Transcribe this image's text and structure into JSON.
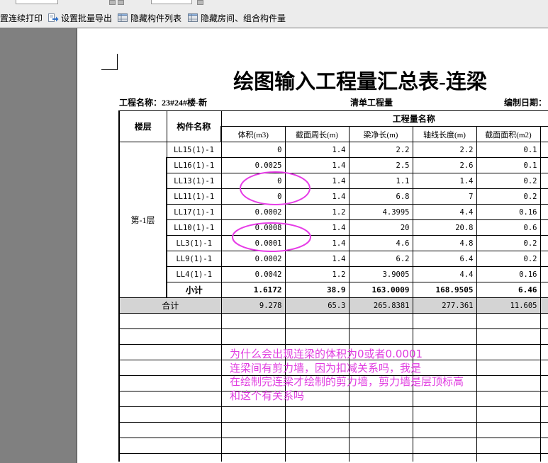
{
  "toolbar": {
    "items": [
      {
        "label": "置连续打印"
      },
      {
        "label": "设置批量导出",
        "icon": "export-icon"
      },
      {
        "label": "隐藏构件列表",
        "icon": "table-icon"
      },
      {
        "label": "隐藏房间、组合构件量",
        "icon": "table-icon"
      }
    ]
  },
  "report": {
    "title": "绘图输入工程量汇总表-连梁",
    "project": "工程名称：23#24#楼-新",
    "quantity_type": "清单工程量",
    "date_label": "编制日期：",
    "header_floor": "楼层",
    "header_component": "构件名称",
    "header_group": "工程量名称",
    "columns": [
      "体积(m3)",
      "截面周长(m)",
      "梁净长(m)",
      "轴线长度(m)",
      "截面面积(m2)"
    ],
    "floor": "第-1层",
    "rows": [
      {
        "name": "LL15(1)-1",
        "values": [
          "0",
          "1.4",
          "2.2",
          "2.2",
          "0.1"
        ]
      },
      {
        "name": "LL16(1)-1",
        "values": [
          "0.0025",
          "1.4",
          "2.5",
          "2.6",
          "0.1"
        ]
      },
      {
        "name": "LL13(1)-1",
        "values": [
          "0",
          "1.4",
          "1.1",
          "1.4",
          "0.2"
        ]
      },
      {
        "name": "LL11(1)-1",
        "values": [
          "0",
          "1.4",
          "6.8",
          "7",
          "0.2"
        ]
      },
      {
        "name": "LL17(1)-1",
        "values": [
          "0.0002",
          "1.2",
          "4.3995",
          "4.4",
          "0.16"
        ]
      },
      {
        "name": "LL10(1)-1",
        "values": [
          "0.0008",
          "1.4",
          "20",
          "20.8",
          "0.6"
        ]
      },
      {
        "name": "LL3(1)-1",
        "values": [
          "0.0001",
          "1.4",
          "4.6",
          "4.8",
          "0.2"
        ]
      },
      {
        "name": "LL9(1)-1",
        "values": [
          "0.0002",
          "1.4",
          "6.2",
          "6.4",
          "0.2"
        ]
      },
      {
        "name": "LL4(1)-1",
        "values": [
          "0.0042",
          "1.2",
          "3.9005",
          "4.4",
          "0.16"
        ]
      }
    ],
    "subtotal": {
      "label": "小计",
      "values": [
        "1.6172",
        "38.9",
        "163.0009",
        "168.9505",
        "6.46"
      ]
    },
    "total": {
      "label": "合计",
      "values": [
        "9.278",
        "65.3",
        "265.8381",
        "277.361",
        "11.605"
      ]
    }
  },
  "annotation": {
    "lines": [
      "为什么会出现连梁的体积为0或者0.0001",
      "连梁间有剪力墙，因为扣减关系吗，我是",
      "在绘制完连梁才绘制的剪力墙，剪力墙是层顶标高",
      "和这个有关系吗"
    ]
  },
  "colors": {
    "annotation": "#e03de0",
    "total_row_bg": "#d4d4d4",
    "workspace_bg": "#808080",
    "toolbar_bg": "#ececec"
  }
}
